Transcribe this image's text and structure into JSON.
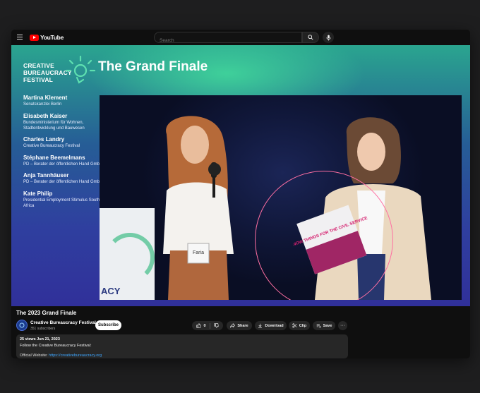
{
  "topbar": {
    "logo_text": "YouTube",
    "search_placeholder": "Search",
    "icons": [
      "menu-icon",
      "search-icon",
      "mic-icon"
    ]
  },
  "video": {
    "brand_lines": [
      "CREATIVE",
      "BUREAUCRACY",
      "FESTIVAL"
    ],
    "slide_title": "The Grand Finale",
    "speakers": [
      {
        "name": "Martina Klement",
        "role": "Senatskanzlei Berlin"
      },
      {
        "name": "Elisabeth Kaiser",
        "role": "Bundesministerium für Wohnen, Stadtentwicklung und Bauwesen"
      },
      {
        "name": "Charles Landry",
        "role": "Creative Bureaucracy Festival"
      },
      {
        "name": "Stéphane Beemelmans",
        "role": "PD – Berater der öffentlichen Hand GmbH"
      },
      {
        "name": "Anja Tannhäuser",
        "role": "PD – Berater der öffentlichen Hand GmbH"
      },
      {
        "name": "Kate Philip",
        "role": "Presidential Employment Stimulus South Africa"
      }
    ],
    "stage_text": "ACY",
    "badge_text": "Faria",
    "book_text": "KNOW THINGS FOR THE CIVIL SERVICE",
    "overlay_color": "#ff6fa2"
  },
  "meta": {
    "title": "The 2023 Grand Finale",
    "channel_name": "Creative Bureaucracy Festival",
    "subscribers": "351 subscribers",
    "subscribe_label": "Subscribe",
    "likes": "0",
    "share_label": "Share",
    "download_label": "Download",
    "clip_label": "Clip",
    "save_label": "Save",
    "more_label": "···"
  },
  "description": {
    "meta": "25 views  Jun 21, 2023",
    "line1": "Follow the Creative Bureaucracy Festival:",
    "website_label": "Official Website:",
    "website_url": "https://creativebureaucracy.org"
  },
  "colors": {
    "accent_red": "#ff0000",
    "link_blue": "#3ea6ff",
    "slide_green": "#3fd09a",
    "slide_blue": "#30309a"
  }
}
